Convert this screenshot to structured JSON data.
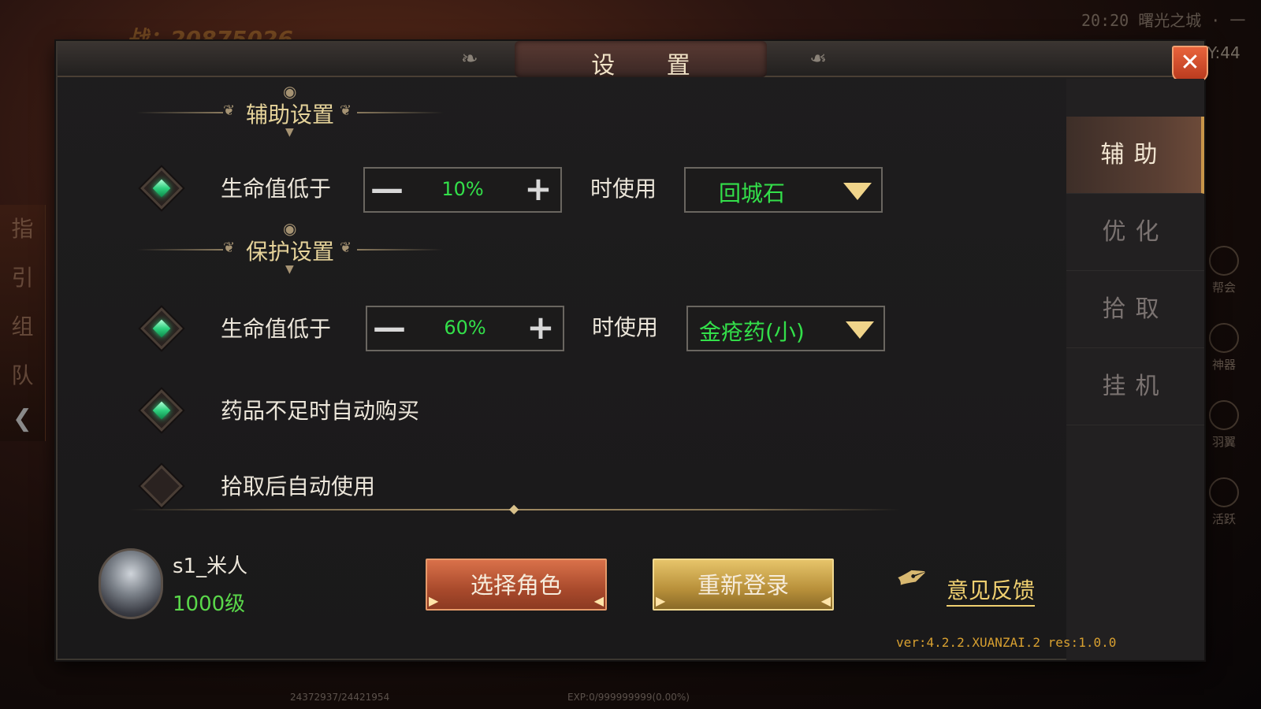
{
  "background": {
    "clock": "20:20  曙光之城 · 一",
    "y_coord": "Y:44",
    "score": "战：20875026",
    "left_hud": [
      "指",
      "引",
      "组",
      "队"
    ],
    "right_icons": [
      "帮会",
      "神器",
      "羽翼",
      "活跃"
    ],
    "hp_text": "24372937/24421954",
    "exp_text": "EXP:0/999999999(0.00%)"
  },
  "dialog": {
    "title": "设 置",
    "close_icon": "close-icon"
  },
  "sections": {
    "assist": {
      "title": "辅助设置"
    },
    "protect": {
      "title": "保护设置"
    }
  },
  "rows": {
    "assist_hp": {
      "checked": true,
      "label": "生命值低于",
      "value": "10%",
      "suffix": "时使用",
      "item": "回城石"
    },
    "protect_hp": {
      "checked": true,
      "label": "生命值低于",
      "value": "60%",
      "suffix": "时使用",
      "item": "金疮药(小)"
    },
    "auto_buy": {
      "checked": true,
      "label": "药品不足时自动购买"
    },
    "auto_use": {
      "checked": false,
      "label": "拾取后自动使用"
    }
  },
  "side_tabs": [
    {
      "label": "辅助",
      "active": true
    },
    {
      "label": "优化",
      "active": false
    },
    {
      "label": "拾取",
      "active": false
    },
    {
      "label": "挂机",
      "active": false
    }
  ],
  "player": {
    "name": "s1_米人",
    "level": "1000级"
  },
  "buttons": {
    "select_role": "选择角色",
    "relogin": "重新登录",
    "feedback": "意见反馈"
  },
  "version": "ver:4.2.2.XUANZAI.2 res:1.0.0",
  "colors": {
    "value_green": "#33e04a",
    "title_gold": "#e6d39a",
    "close_red": "#d9552f"
  }
}
